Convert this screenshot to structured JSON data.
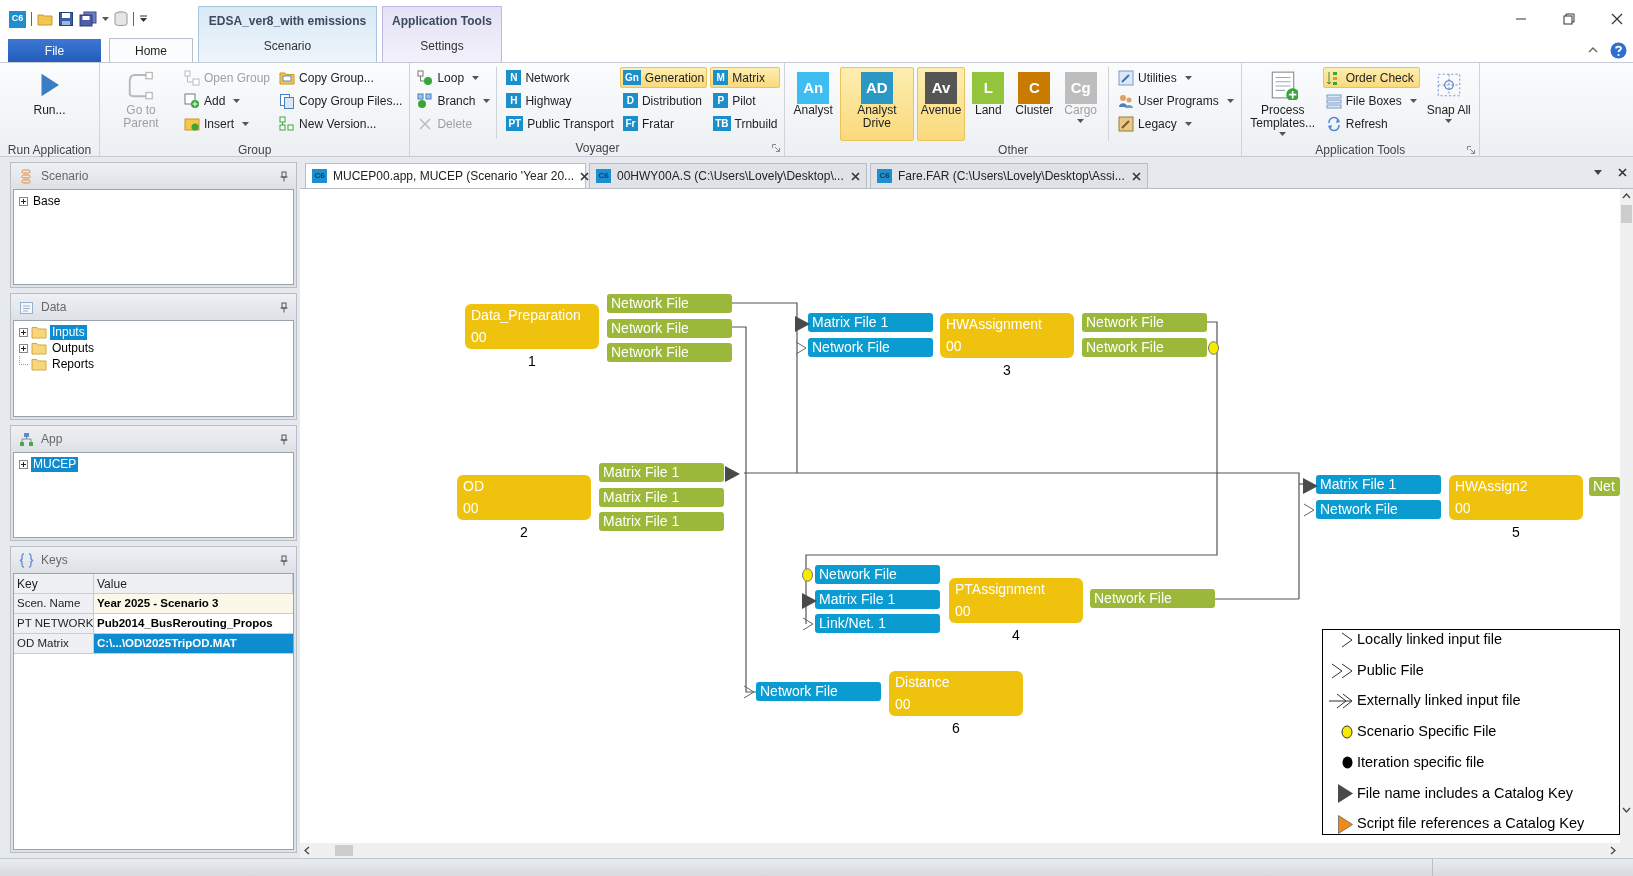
{
  "app_badge": "C6",
  "context_tabs": [
    {
      "title": "EDSA_ver8_with emissions",
      "tab": "Scenario",
      "selected": false
    },
    {
      "title": "Application Tools",
      "tab": "Settings",
      "selected": false
    }
  ],
  "ribbon_tabs": [
    {
      "label": "File",
      "kind": "file",
      "selected": false
    },
    {
      "label": "Home",
      "kind": "tab",
      "selected": true
    }
  ],
  "ribbon_groups": [
    {
      "label": "Run Application",
      "launcher": false,
      "columns": [
        {
          "items": [
            {
              "kind": "large",
              "label": "Run...",
              "disabled": false,
              "dropdown": false,
              "highlighted": false
            }
          ]
        }
      ]
    },
    {
      "label": "Group",
      "launcher": false,
      "columns": [
        {
          "items": [
            {
              "kind": "large",
              "label": "Go to Parent",
              "disabled": true,
              "dropdown": false,
              "highlighted": false
            }
          ]
        },
        {
          "items": [
            {
              "kind": "small",
              "label": "Open Group",
              "disabled": true,
              "dropdown": false,
              "highlighted": false
            },
            {
              "kind": "small",
              "label": "Add",
              "disabled": false,
              "dropdown": true,
              "highlighted": false
            },
            {
              "kind": "small",
              "label": "Insert",
              "disabled": false,
              "dropdown": true,
              "highlighted": false
            }
          ]
        },
        {
          "items": [
            {
              "kind": "small",
              "label": "Copy Group...",
              "disabled": false,
              "dropdown": false,
              "highlighted": false
            },
            {
              "kind": "small",
              "label": "Copy Group Files...",
              "disabled": false,
              "dropdown": false,
              "highlighted": false
            },
            {
              "kind": "small",
              "label": "New Version...",
              "disabled": false,
              "dropdown": false,
              "highlighted": false
            }
          ]
        }
      ]
    },
    {
      "label": "Voyager",
      "launcher": true,
      "columns": [
        {
          "items": [
            {
              "kind": "small",
              "label": "Loop",
              "disabled": false,
              "dropdown": true,
              "highlighted": false
            },
            {
              "kind": "small",
              "label": "Branch",
              "disabled": false,
              "dropdown": true,
              "highlighted": false
            },
            {
              "kind": "small",
              "label": "Delete",
              "disabled": true,
              "dropdown": false,
              "highlighted": false
            }
          ]
        },
        {
          "items": [
            {
              "kind": "badge",
              "badge": "N",
              "label": "Network",
              "disabled": false,
              "dropdown": false,
              "highlighted": false
            },
            {
              "kind": "badge",
              "badge": "H",
              "label": "Highway",
              "disabled": false,
              "dropdown": false,
              "highlighted": false
            },
            {
              "kind": "badge",
              "badge": "PT",
              "label": "Public Transport",
              "disabled": false,
              "dropdown": false,
              "highlighted": false
            }
          ]
        },
        {
          "items": [
            {
              "kind": "badge",
              "badge": "Gn",
              "label": "Generation",
              "disabled": false,
              "dropdown": false,
              "highlighted": true
            },
            {
              "kind": "badge",
              "badge": "D",
              "label": "Distribution",
              "disabled": false,
              "dropdown": false,
              "highlighted": false
            },
            {
              "kind": "badge",
              "badge": "Fr",
              "label": "Fratar",
              "disabled": false,
              "dropdown": false,
              "highlighted": false
            }
          ]
        },
        {
          "items": [
            {
              "kind": "badge",
              "badge": "M",
              "label": "Matrix",
              "disabled": false,
              "dropdown": false,
              "highlighted": true
            },
            {
              "kind": "badge",
              "badge": "P",
              "label": "Pilot",
              "disabled": false,
              "dropdown": false,
              "highlighted": false
            },
            {
              "kind": "badge",
              "badge": "TB",
              "label": "Trnbuild",
              "disabled": false,
              "dropdown": false,
              "highlighted": false
            }
          ]
        }
      ]
    },
    {
      "label": "Other",
      "launcher": false,
      "columns": [
        {
          "items": [
            {
              "kind": "large_badge",
              "badge": "An",
              "color": "#3dbdf0",
              "label": "Analyst",
              "disabled": false,
              "dropdown": false,
              "highlighted": false
            }
          ]
        },
        {
          "items": [
            {
              "kind": "large_badge",
              "badge": "AD",
              "color": "#2a97c4",
              "label": "Analyst Drive",
              "disabled": false,
              "dropdown": false,
              "highlighted": true
            }
          ]
        },
        {
          "items": [
            {
              "kind": "large_badge",
              "badge": "Av",
              "color": "#555555",
              "label": "Avenue",
              "disabled": false,
              "dropdown": false,
              "highlighted": true
            }
          ]
        },
        {
          "items": [
            {
              "kind": "large_badge",
              "badge": "L",
              "color": "#94c33c",
              "label": "Land",
              "disabled": false,
              "dropdown": false,
              "highlighted": false
            }
          ]
        },
        {
          "items": [
            {
              "kind": "large_badge",
              "badge": "C",
              "color": "#c97a00",
              "label": "Cluster",
              "disabled": false,
              "dropdown": false,
              "highlighted": false
            }
          ]
        },
        {
          "items": [
            {
              "kind": "large_badge",
              "badge": "Cg",
              "color": "#bdbdbd",
              "label": "Cargo",
              "disabled": true,
              "dropdown": true,
              "highlighted": false
            }
          ]
        },
        {
          "items": [
            {
              "kind": "small",
              "label": "Utilities",
              "disabled": false,
              "dropdown": true,
              "highlighted": false
            },
            {
              "kind": "small",
              "label": "User Programs",
              "disabled": false,
              "dropdown": true,
              "highlighted": false
            },
            {
              "kind": "small",
              "label": "Legacy",
              "disabled": false,
              "dropdown": true,
              "highlighted": false
            }
          ]
        }
      ]
    },
    {
      "label": "Application Tools",
      "launcher": true,
      "columns": [
        {
          "items": [
            {
              "kind": "large",
              "label": "Process Templates...",
              "disabled": false,
              "dropdown": true,
              "highlighted": false
            }
          ]
        },
        {
          "items": [
            {
              "kind": "small",
              "label": "Order Check",
              "disabled": false,
              "dropdown": false,
              "highlighted": true
            },
            {
              "kind": "small",
              "label": "File Boxes",
              "disabled": false,
              "dropdown": true,
              "highlighted": false
            },
            {
              "kind": "small",
              "label": "Refresh",
              "disabled": false,
              "dropdown": false,
              "highlighted": false
            }
          ]
        },
        {
          "items": [
            {
              "kind": "large",
              "label": "Snap All",
              "disabled": false,
              "dropdown": true,
              "highlighted": false
            }
          ]
        }
      ]
    }
  ],
  "panels": [
    {
      "title": "Scenario",
      "kind": "tree",
      "tree": [
        {
          "label": "Base",
          "kind": "item",
          "expandable": true,
          "selected": false
        }
      ]
    },
    {
      "title": "Data",
      "kind": "tree",
      "tree": [
        {
          "label": "Inputs",
          "kind": "folder",
          "expandable": true,
          "selected": true
        },
        {
          "label": "Outputs",
          "kind": "folder",
          "expandable": true,
          "selected": false
        },
        {
          "label": "Reports",
          "kind": "folder",
          "expandable": false,
          "selected": false
        }
      ]
    },
    {
      "title": "App",
      "kind": "tree",
      "tree": [
        {
          "label": "MUCEP",
          "kind": "item",
          "expandable": true,
          "selected": true
        }
      ]
    },
    {
      "title": "Keys",
      "kind": "table",
      "columns": [
        "Key",
        "Value"
      ],
      "rows": [
        {
          "key": "Scen. Name",
          "value": "Year 2025 - Scenario 3",
          "highlighted": true,
          "selected": false
        },
        {
          "key": "PT NETWORK",
          "value": "Pub2014_BusRerouting_Propos",
          "highlighted": false,
          "selected": false
        },
        {
          "key": "OD Matrix",
          "value": "C:\\...\\OD\\2025TripOD.MAT",
          "highlighted": false,
          "selected": true
        }
      ]
    }
  ],
  "doc_tabs": [
    {
      "badge": "C6",
      "label": "MUCEP00.app, MUCEP (Scenario 'Year 20...",
      "selected": true
    },
    {
      "badge": "C6",
      "label": "00HWY00A.S (C:\\Users\\Lovely\\Desktop\\...",
      "selected": false
    },
    {
      "badge": "C6",
      "label": "Fare.FAR (C:\\Users\\Lovely\\Desktop\\Assi...",
      "selected": false
    }
  ],
  "nodes": [
    {
      "name": "Data_Preparation",
      "group": "00",
      "number": "1",
      "outputs": [
        {
          "label": "Network File",
          "kind": "plain"
        },
        {
          "label": "Network File",
          "kind": "plain"
        },
        {
          "label": "Network File",
          "kind": "plain"
        }
      ]
    },
    {
      "name": "OD",
      "group": "00",
      "number": "2",
      "outputs": [
        {
          "label": "Matrix File 1",
          "kind": "catalog"
        },
        {
          "label": "Matrix File 1",
          "kind": "plain"
        },
        {
          "label": "Matrix File 1",
          "kind": "plain"
        }
      ]
    },
    {
      "name": "HWAssignment",
      "group": "00",
      "number": "3",
      "inputs": [
        {
          "label": "Matrix File 1",
          "kind": "catalog"
        },
        {
          "label": "Network File",
          "kind": "local"
        }
      ],
      "outputs": [
        {
          "label": "Network File",
          "kind": "plain"
        },
        {
          "label": "Network File",
          "kind": "scenario"
        }
      ]
    },
    {
      "name": "PTAssignment",
      "group": "00",
      "number": "4",
      "inputs": [
        {
          "label": "Network File",
          "kind": "scenario"
        },
        {
          "label": "Matrix File 1",
          "kind": "catalog"
        },
        {
          "label": "Link/Net. 1",
          "kind": "local"
        }
      ],
      "outputs": [
        {
          "label": "Network File",
          "kind": "plain"
        }
      ]
    },
    {
      "name": "HWAssign2",
      "group": "00",
      "number": "5",
      "inputs": [
        {
          "label": "Matrix File 1",
          "kind": "catalog"
        },
        {
          "label": "Network File",
          "kind": "local"
        }
      ],
      "outputs": [
        {
          "label": "Net",
          "kind": "plain"
        }
      ]
    },
    {
      "name": "Distance",
      "group": "00",
      "number": "6",
      "inputs": [
        {
          "label": "Network File",
          "kind": "local"
        }
      ]
    }
  ],
  "legend": [
    {
      "kind": "local",
      "label": "Locally linked input file"
    },
    {
      "kind": "public",
      "label": "Public File"
    },
    {
      "kind": "external",
      "label": "Externally linked input file"
    },
    {
      "kind": "scenario",
      "label": "Scenario Specific File"
    },
    {
      "kind": "iteration",
      "label": "Iteration specific file"
    },
    {
      "kind": "catalog",
      "label": "File name includes a Catalog Key"
    },
    {
      "kind": "script",
      "label": "Script file references a Catalog Key"
    }
  ]
}
